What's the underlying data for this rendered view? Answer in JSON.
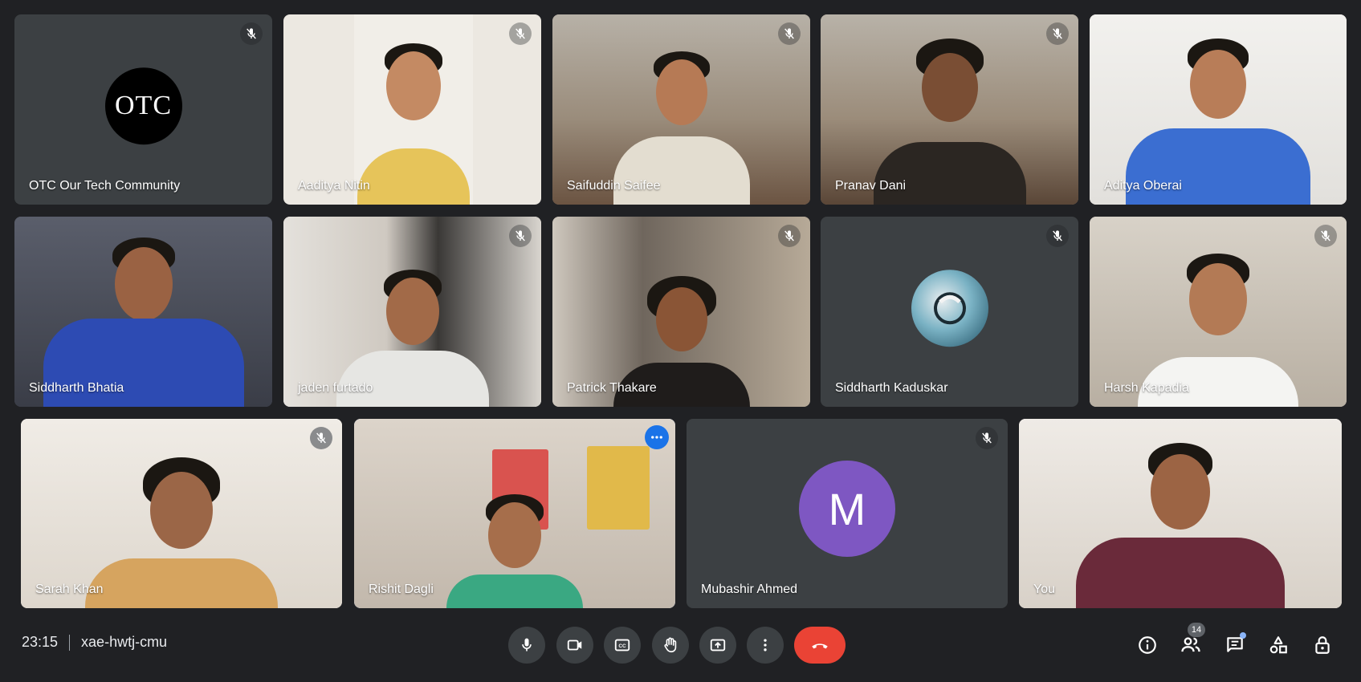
{
  "meeting": {
    "time": "23:15",
    "code": "xae-hwtj-cmu"
  },
  "participants": [
    {
      "name": "OTC Our Tech Community",
      "muted": true,
      "avatar_text": "OTC",
      "video": false
    },
    {
      "name": "Aaditya Nitin",
      "muted": true,
      "video": true
    },
    {
      "name": "Saifuddin Saifee",
      "muted": true,
      "video": true
    },
    {
      "name": "Pranav Dani",
      "muted": true,
      "video": true
    },
    {
      "name": "Aditya Oberai",
      "muted": false,
      "video": true
    },
    {
      "name": "Siddharth Bhatia",
      "muted": false,
      "video": true
    },
    {
      "name": "jaden furtado",
      "muted": true,
      "video": true
    },
    {
      "name": "Patrick Thakare",
      "muted": true,
      "video": true
    },
    {
      "name": "Siddharth Kaduskar",
      "muted": true,
      "video": false
    },
    {
      "name": "Harsh Kapadia",
      "muted": true,
      "video": true
    },
    {
      "name": "Sarah Khan",
      "muted": true,
      "video": true
    },
    {
      "name": "Rishit Dagli",
      "muted": false,
      "video": true,
      "active": true
    },
    {
      "name": "Mubashir Ahmed",
      "muted": true,
      "avatar_text": "M",
      "video": false
    },
    {
      "name": "You",
      "muted": false,
      "video": true
    }
  ],
  "controls": {
    "mic": "microphone-icon",
    "camera": "camera-icon",
    "captions": "captions-icon",
    "raise_hand": "hand-icon",
    "present": "present-icon",
    "more": "more-options-icon",
    "leave": "end-call-icon"
  },
  "side": {
    "people_count": "14"
  },
  "colors": {
    "background": "#202124",
    "tile": "#3c4043",
    "end_call": "#ea4335",
    "active_outline": "#8ab4f8",
    "avatar_m": "#7e57c2"
  }
}
